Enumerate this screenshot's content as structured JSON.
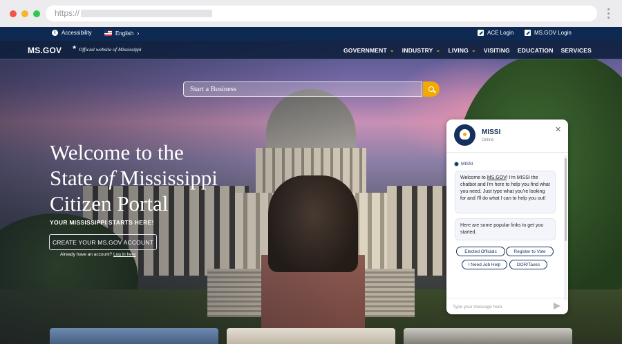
{
  "browser": {
    "url_prefix": "https://"
  },
  "utility_bar": {
    "accessibility": "Accessibility",
    "language": "English",
    "ace_login": "ACE Login",
    "msgov_login": "MS.GOV Login"
  },
  "nav": {
    "logo": "MS.GOV",
    "official": "Official website of Mississippi",
    "links": [
      "GOVERNMENT",
      "INDUSTRY",
      "LIVING",
      "VISITING",
      "EDUCATION",
      "SERVICES"
    ]
  },
  "search": {
    "placeholder": "Start a Business"
  },
  "hero": {
    "line1": "Welcome to the",
    "line2_a": "State ",
    "line2_b": "of",
    "line2_c": " Mississippi",
    "line3": "Citizen Portal",
    "tagline": "YOUR MISSISSIPPI STARTS HERE!",
    "create_button": "CREATE YOUR MS.GOV ACCOUNT",
    "already": "Already have an account? ",
    "login_link": "Log in here"
  },
  "chat": {
    "name": "MISSI",
    "status": "Online",
    "bot_label": "MISSI",
    "msg1_a": "Welcome to ",
    "msg1_link": "MS.GOV",
    "msg1_b": "! I'm MISSI the chatbot and I'm here to help you find what you need. Just type what you're looking for and I'll do what I can to help you out!",
    "msg2": "Here are some popular links to get you started.",
    "quick_links": [
      "Elected Officials",
      "Register to Vote",
      "I Need Job Help",
      "DOR/Taxes"
    ],
    "input_placeholder": "Type your message here"
  },
  "colors": {
    "navy": "#0f2a52",
    "accent": "#f2a900"
  }
}
